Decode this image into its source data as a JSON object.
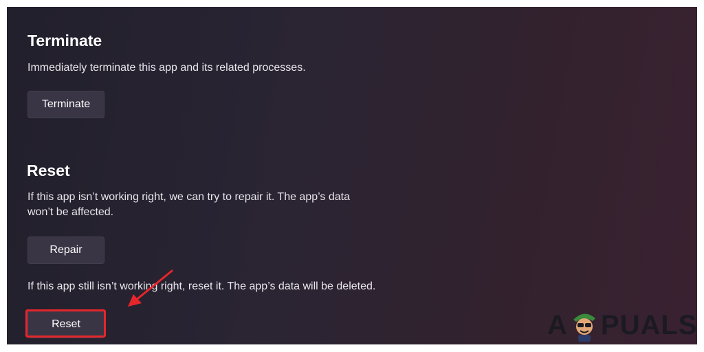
{
  "terminate": {
    "title": "Terminate",
    "description": "Immediately terminate this app and its related processes.",
    "button_label": "Terminate"
  },
  "reset": {
    "title": "Reset",
    "repair_description_line1": "If this app isn’t working right, we can try to repair it. The app’s data",
    "repair_description_line2": "won’t be affected.",
    "repair_button_label": "Repair",
    "reset_description": "If this app still isn’t working right, reset it. The app’s data will be deleted.",
    "reset_button_label": "Reset"
  },
  "watermark": {
    "letter_a": "A",
    "rest": "PUALS"
  },
  "colors": {
    "annotation": "#e6262b",
    "button_bg": "#3a3545"
  }
}
